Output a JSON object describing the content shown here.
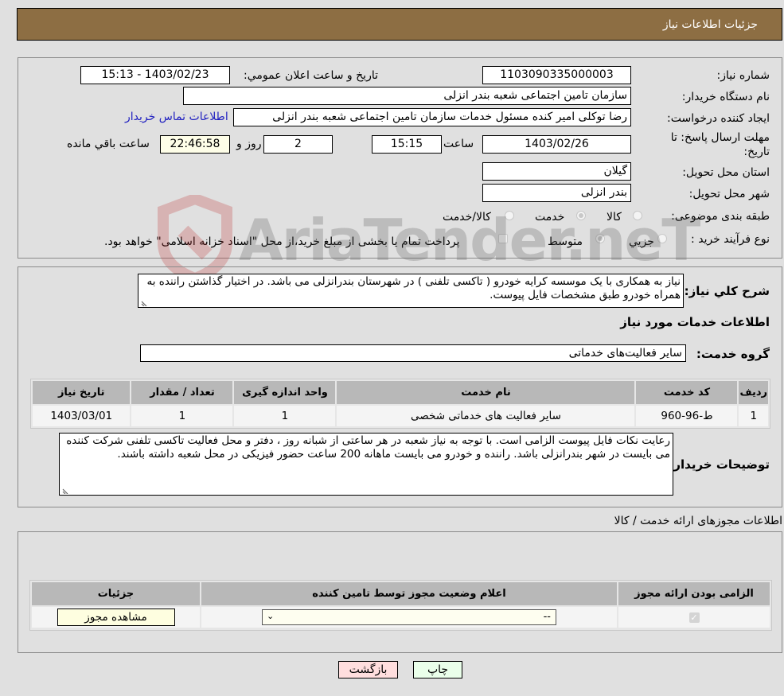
{
  "header": {
    "title": "جزئیات اطلاعات نیاز"
  },
  "form": {
    "need_number": {
      "label": "شماره نیاز:",
      "value": "1103090335000003"
    },
    "announce_datetime": {
      "label": "تاریخ و ساعت اعلان عمومي:",
      "value": "1403/02/23 - 15:13"
    },
    "buyer_org": {
      "label": "نام دستگاه خریدار:",
      "value": "سازمان تامین اجتماعی شعبه بندر انزلی"
    },
    "requester": {
      "label": "ایجاد کننده درخواست:",
      "value": "رضا توکلی امیر کنده مسئول خدمات سازمان تامین اجتماعی شعبه بندر انزلی"
    },
    "buyer_contact_link": "اطلاعات تماس خریدار",
    "deadline": {
      "label": "مهلت ارسال پاسخ: تا تاریخ:",
      "date": "1403/02/26",
      "time_label": "ساعت",
      "time": "15:15",
      "days": "2",
      "days_label": "روز و",
      "remaining": "22:46:58",
      "remaining_label": "ساعت باقي مانده"
    },
    "province": {
      "label": "استان محل تحویل:",
      "value": "گیلان"
    },
    "city": {
      "label": "شهر محل تحویل:",
      "value": "بندر انزلی"
    },
    "category": {
      "label": "طبقه بندی موضوعی:",
      "options": [
        "کالا",
        "خدمت",
        "کالا/خدمت"
      ],
      "selected": "خدمت"
    },
    "process_type": {
      "label": "نوع فرآیند خرید :",
      "options": [
        "جزيي",
        "متوسط"
      ],
      "selected": "متوسط",
      "treasury_note": "پرداخت تمام یا بخشی از مبلغ خرید،از محل \"اسناد خزانه اسلامی\" خواهد بود."
    },
    "description": {
      "label": "شرح کلي نياز:",
      "value": "نیاز به همکاری با یک موسسه کرایه خودرو ( تاکسی تلفنی ) در شهرستان بندرانزلی می باشد. در اختیار گذاشتن راننده به همراه خودرو طبق مشخصات فایل پیوست."
    },
    "services_section_title": "اطلاعات خدمات مورد نیاز",
    "service_group": {
      "label": "گروه خدمت:",
      "value": "سایر فعالیت‌های خدماتی"
    }
  },
  "services_table": {
    "headers": [
      "ردیف",
      "کد خدمت",
      "نام خدمت",
      "واحد اندازه گیری",
      "تعداد / مقدار",
      "تاریخ نیاز"
    ],
    "rows": [
      [
        "1",
        "ط-96-960",
        "سایر فعالیت های خدماتی شخصی",
        "1",
        "1",
        "1403/03/01"
      ]
    ]
  },
  "buyer_notes": {
    "label": "توضیحات خریدار:",
    "value": "رعایت نکات فایل پیوست الزامی است. با توجه به نیاز شعبه در هر ساعتی از شبانه روز ، دفتر و محل فعالیت تاکسی تلفنی شرکت کننده می بایست در شهر بندرانزلی باشد. راننده و خودرو می بایست ماهانه 200 ساعت حضور فیزیکی در محل شعبه داشته باشند."
  },
  "permits": {
    "section_title": "اطلاعات مجوزهای ارائه خدمت / کالا",
    "headers": [
      "الزامی بودن ارائه مجوز",
      "اعلام وضعیت مجوز توسط تامین کننده",
      "جزئیات"
    ],
    "row": {
      "required_checked": true,
      "status_value": "--",
      "view_button": "مشاهده مجوز"
    }
  },
  "footer": {
    "print_button": "چاپ",
    "back_button": "بازگشت"
  },
  "watermark": "AriaTender.neT"
}
